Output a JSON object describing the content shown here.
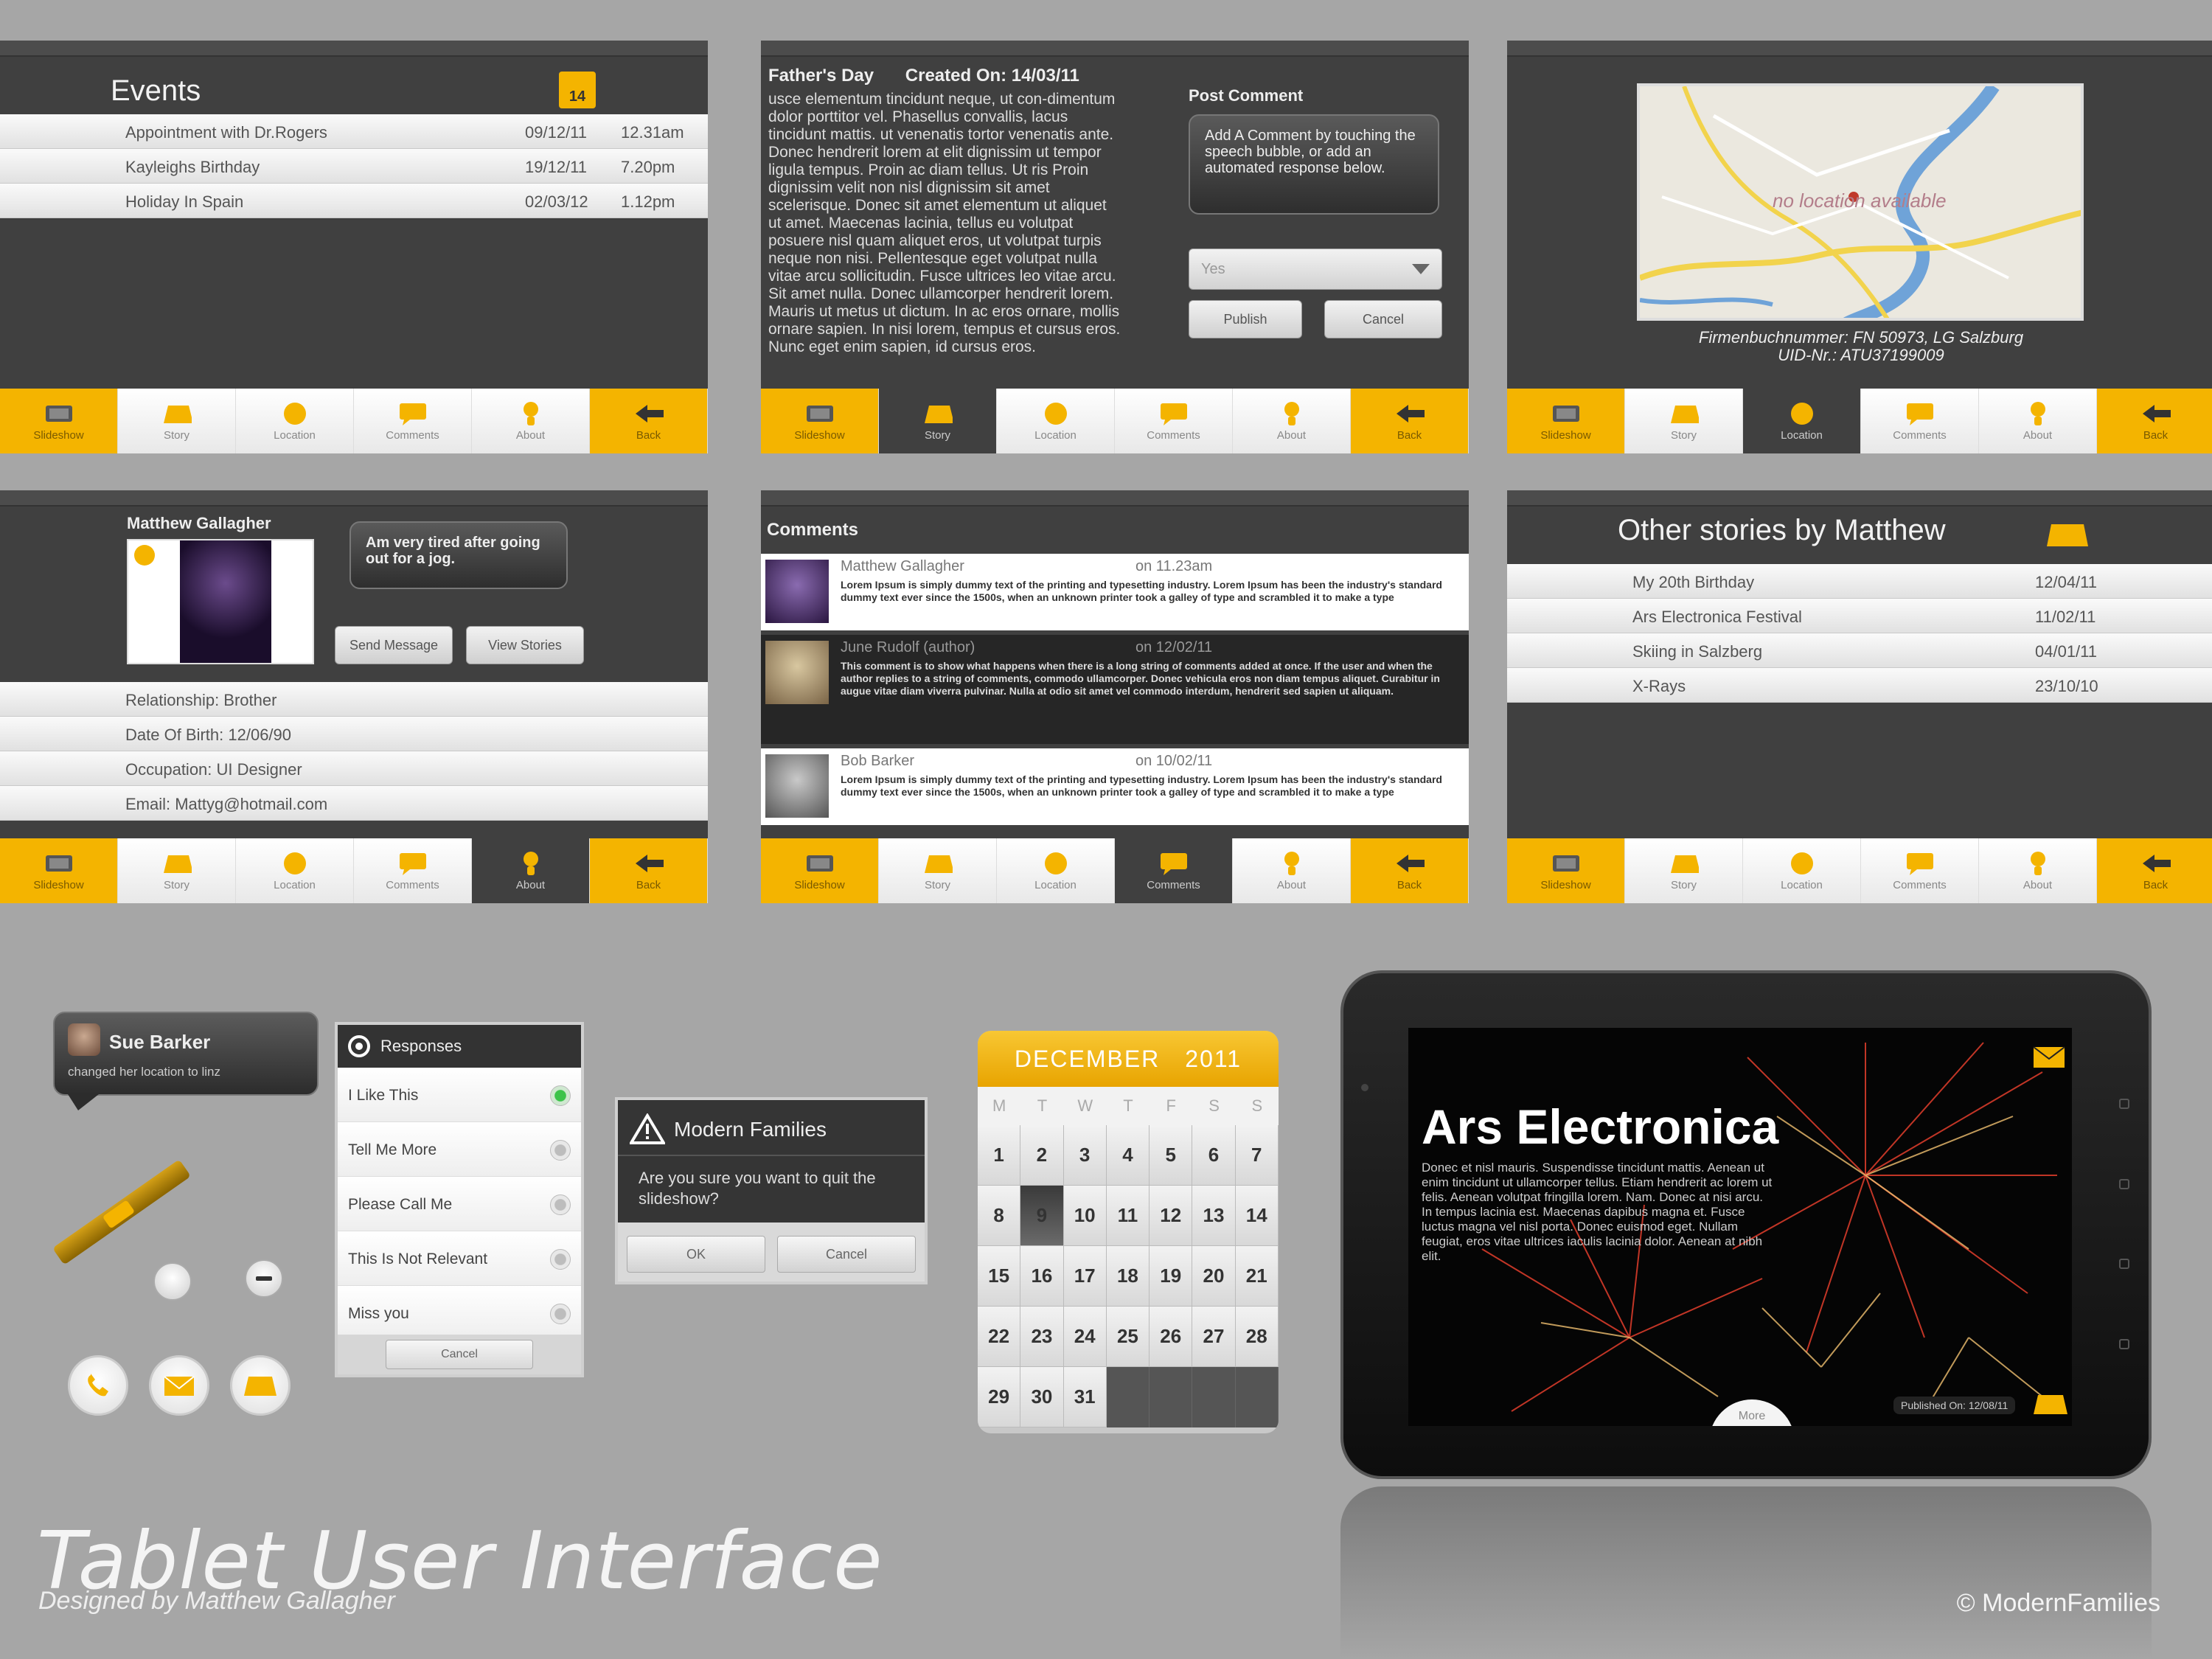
{
  "nav_labels": [
    "Slideshow",
    "Story",
    "Location",
    "Comments",
    "About",
    "Back"
  ],
  "events": {
    "title": "Events",
    "badge": "14",
    "rows": [
      {
        "name": "Appointment with Dr.Rogers",
        "date": "09/12/11",
        "time": "12.31am"
      },
      {
        "name": "Kayleighs Birthday",
        "date": "19/12/11",
        "time": "7.20pm"
      },
      {
        "name": "Holiday In Spain",
        "date": "02/03/12",
        "time": "1.12pm"
      }
    ]
  },
  "story": {
    "title": "Father's Day",
    "created": "Created On: 14/03/11",
    "body": "usce elementum tincidunt neque, ut con-dimentum dolor porttitor vel. Phasellus convallis, lacus tincidunt mattis. ut venenatis tortor venenatis ante. Donec hendrerit lorem at elit dignissim ut tempor ligula tempus. Proin ac diam tellus. Ut ris Proin dignissim velit non nisl dignissim sit amet scelerisque. Donec sit amet elementum ut aliquet ut amet. Maecenas lacinia, tellus eu volutpat posuere nisl quam aliquet eros, ut volutpat turpis neque non nisi. Pellentesque eget volutpat nulla vitae arcu sollicitudin. Fusce ultrices leo vitae arcu. Sit amet nulla. Donec ullamcorper hendrerit lorem. Mauris ut metus ut dictum. In ac eros ornare, mollis ornare sapien. In nisi lorem, tempus et cursus eros. Nunc eget enim sapien, id cursus eros.",
    "post_comment_label": "Post Comment",
    "comment_placeholder": "Add A Comment by touching the speech bubble, or add an automated response below.",
    "select_value": "Yes",
    "publish": "Publish",
    "cancel": "Cancel"
  },
  "location": {
    "map_text": "no location available",
    "caption1": "Firmenbuchnummer: FN 50973, LG Salzburg",
    "caption2": "UID-Nr.: ATU37199009"
  },
  "profile": {
    "name": "Matthew Gallagher",
    "status": "Am very tired after going out for a jog.",
    "send_message": "Send Message",
    "view_stories": "View Stories",
    "rows": [
      "Relationship: Brother",
      "Date Of Birth: 12/06/90",
      "Occupation: UI Designer",
      "Email: Mattyg@hotmail.com"
    ]
  },
  "comments": {
    "title": "Comments",
    "items": [
      {
        "author": "Matthew Gallagher",
        "time": "on 11.23am",
        "text": "Lorem Ipsum is simply dummy text of the printing and typesetting industry. Lorem Ipsum has been the industry's standard dummy text ever since the 1500s, when an unknown printer took a galley of type and scrambled it to make a type"
      },
      {
        "author": "June Rudolf  (author)",
        "time": "on 12/02/11",
        "text": "This comment is to show what happens when there is a long string of comments added at once. If the user and when the author replies to a string of comments, commodo ullamcorper. Donec vehicula eros non diam tempus aliquet. Curabitur in augue vitae diam viverra pulvinar. Nulla at odio sit amet vel commodo interdum, hendrerit sed sapien ut aliquam."
      },
      {
        "author": "Bob Barker",
        "time": "on 10/02/11",
        "text": "Lorem Ipsum is simply dummy text of the printing and typesetting industry. Lorem Ipsum has been the industry's standard dummy text ever since the 1500s, when an unknown printer took a galley of type and scrambled it to make a type"
      }
    ]
  },
  "other_stories": {
    "title": "Other stories by Matthew",
    "rows": [
      {
        "name": "My 20th Birthday",
        "date": "12/04/11"
      },
      {
        "name": "Ars Electronica Festival",
        "date": "11/02/11"
      },
      {
        "name": "Skiing in Salzberg",
        "date": "04/01/11"
      },
      {
        "name": "X-Rays",
        "date": "23/10/10"
      }
    ]
  },
  "notification": {
    "name": "Sue Barker",
    "text": "changed her location to linz"
  },
  "responses": {
    "title": "Responses",
    "options": [
      "I Like This",
      "Tell Me More",
      "Please Call Me",
      "This Is Not Relevant",
      "Miss you"
    ],
    "cancel": "Cancel"
  },
  "dialog": {
    "title": "Modern Families",
    "message": "Are you sure you want to quit the slideshow?",
    "ok": "OK",
    "cancel": "Cancel"
  },
  "calendar": {
    "month": "DECEMBER",
    "year": "2011",
    "weekdays": [
      "M",
      "T",
      "W",
      "T",
      "F",
      "S",
      "S"
    ],
    "days": [
      "1",
      "2",
      "3",
      "4",
      "5",
      "6",
      "7",
      "8",
      "9",
      "10",
      "11",
      "12",
      "13",
      "14",
      "15",
      "16",
      "17",
      "18",
      "19",
      "20",
      "21",
      "22",
      "23",
      "24",
      "25",
      "26",
      "27",
      "28",
      "29",
      "30",
      "31"
    ],
    "selected": "9"
  },
  "tablet": {
    "title": "Ars Electronica",
    "body": "Donec et nisl mauris. Suspendisse tincidunt mattis. Aenean ut enim tincidunt ut ullamcorper tellus. Etiam hendrerit ac lorem ut felis. Aenean volutpat fringilla lorem. Nam. Donec at nisi arcu. In tempus lacinia est. Maecenas dapibus magna et. Fusce luctus magna vel nisl porta. Donec euismod eget. Nullam feugiat, eros vitae ultrices iaculis lacinia dolor. Aenean at nibh elit.",
    "more": "More",
    "published": "Published On: 12/08/11"
  },
  "footer": {
    "title": "Tablet User Interface",
    "subtitle": "Designed by Matthew Gallagher",
    "copyright": "© ModernFamilies"
  },
  "colors": {
    "accent": "#f4b400",
    "panel": "#404040",
    "background": "#a6a6a6"
  }
}
